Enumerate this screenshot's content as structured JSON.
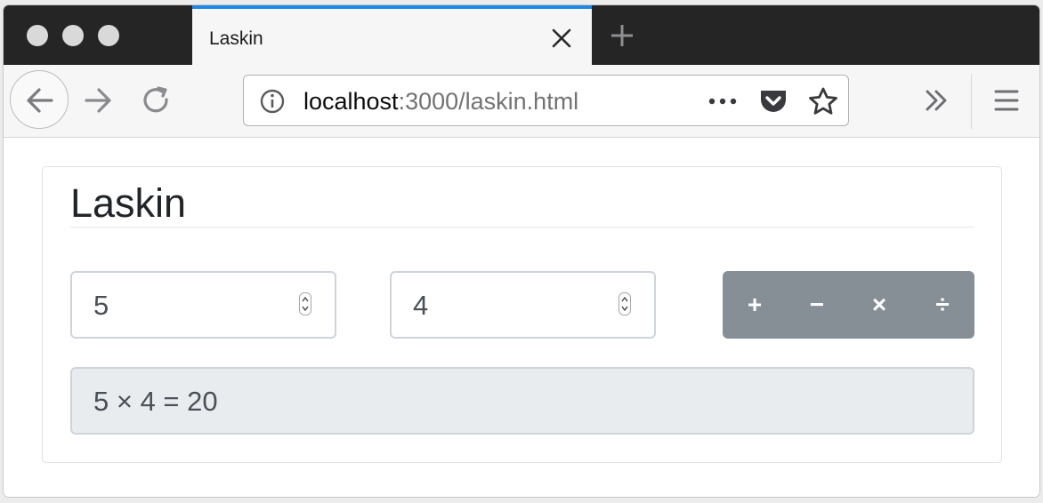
{
  "window": {
    "traffic_lights": [
      "close",
      "minimize",
      "zoom"
    ]
  },
  "tabs": [
    {
      "title": "Laskin",
      "active": true
    }
  ],
  "toolbar": {
    "url_host": "localhost",
    "url_rest": ":3000/laskin.html",
    "url_icons": [
      "info-icon",
      "more-icon",
      "pocket-icon",
      "star-icon"
    ],
    "nav_icons": [
      "back-icon",
      "forward-icon",
      "reload-icon",
      "overflow-icon",
      "menu-icon"
    ]
  },
  "app": {
    "heading": "Laskin",
    "input_a": "5",
    "input_b": "4",
    "operations": [
      {
        "symbol": "+"
      },
      {
        "symbol": "−"
      },
      {
        "symbol": "×"
      },
      {
        "symbol": "÷"
      }
    ],
    "result": "5 × 4 = 20"
  },
  "colors": {
    "tab_accent": "#1e88e5",
    "tabbar_bg": "#252526",
    "button_bg": "#868e96",
    "result_bg": "#e9ecef"
  }
}
